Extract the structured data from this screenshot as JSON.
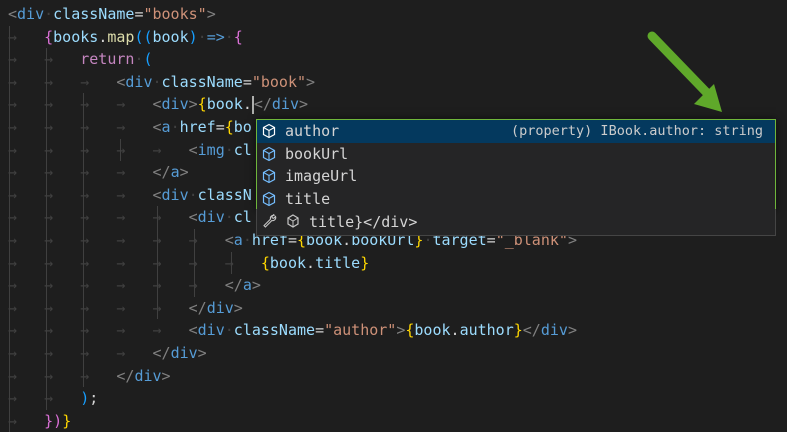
{
  "editor": {
    "lines": [
      {
        "segments": [
          {
            "c": "tag",
            "t": "<"
          },
          {
            "c": "tname",
            "t": "div"
          },
          {
            "c": "ws",
            "t": "·"
          },
          {
            "c": "attr",
            "t": "className"
          },
          {
            "c": "plain",
            "t": "="
          },
          {
            "c": "str",
            "t": "\"books\""
          },
          {
            "c": "tag",
            "t": ">"
          }
        ]
      },
      {
        "segments": [
          {
            "c": "ws",
            "t": "→   "
          },
          {
            "c": "brace",
            "t": "{"
          },
          {
            "c": "var",
            "t": "books"
          },
          {
            "c": "plain",
            "t": "."
          },
          {
            "c": "fn",
            "t": "map"
          },
          {
            "c": "brace2",
            "t": "(("
          },
          {
            "c": "var",
            "t": "book"
          },
          {
            "c": "brace2",
            "t": ")"
          },
          {
            "c": "ws",
            "t": "·"
          },
          {
            "c": "tname",
            "t": "=>"
          },
          {
            "c": "ws",
            "t": "·"
          },
          {
            "c": "brace",
            "t": "{"
          }
        ]
      },
      {
        "segments": [
          {
            "c": "ws",
            "t": "→   →   "
          },
          {
            "c": "kw",
            "t": "return"
          },
          {
            "c": "ws",
            "t": "·"
          },
          {
            "c": "brace2",
            "t": "("
          }
        ]
      },
      {
        "segments": [
          {
            "c": "ws",
            "t": "→   →   →   "
          },
          {
            "c": "tag",
            "t": "<"
          },
          {
            "c": "tname",
            "t": "div"
          },
          {
            "c": "ws",
            "t": "·"
          },
          {
            "c": "attr",
            "t": "className"
          },
          {
            "c": "plain",
            "t": "="
          },
          {
            "c": "str",
            "t": "\"book\""
          },
          {
            "c": "tag",
            "t": ">"
          }
        ]
      },
      {
        "segments": [
          {
            "c": "ws",
            "t": "→   →   →   →   "
          },
          {
            "c": "tag",
            "t": "<"
          },
          {
            "c": "tname",
            "t": "div"
          },
          {
            "c": "tag",
            "t": ">"
          },
          {
            "c": "brace3",
            "t": "{"
          },
          {
            "c": "var",
            "t": "book"
          },
          {
            "c": "plain",
            "t": "."
          },
          {
            "c": "cursor",
            "t": ""
          },
          {
            "c": "tag",
            "t": "</"
          },
          {
            "c": "tname",
            "t": "div"
          },
          {
            "c": "tag",
            "t": ">"
          }
        ]
      },
      {
        "segments": [
          {
            "c": "ws",
            "t": "→   →   →   →   "
          },
          {
            "c": "tag",
            "t": "<"
          },
          {
            "c": "tname",
            "t": "a"
          },
          {
            "c": "ws",
            "t": "·"
          },
          {
            "c": "attr",
            "t": "href"
          },
          {
            "c": "plain",
            "t": "="
          },
          {
            "c": "brace3",
            "t": "{"
          },
          {
            "c": "var",
            "t": "bo"
          }
        ]
      },
      {
        "segments": [
          {
            "c": "ws",
            "t": "→   →   →   →   →   "
          },
          {
            "c": "tag",
            "t": "<"
          },
          {
            "c": "tname",
            "t": "img"
          },
          {
            "c": "ws",
            "t": "·"
          },
          {
            "c": "attr",
            "t": "cl"
          }
        ]
      },
      {
        "segments": [
          {
            "c": "ws",
            "t": "→   →   →   →   "
          },
          {
            "c": "tag",
            "t": "</"
          },
          {
            "c": "tname",
            "t": "a"
          },
          {
            "c": "tag",
            "t": ">"
          }
        ]
      },
      {
        "segments": [
          {
            "c": "ws",
            "t": "→   →   →   →   "
          },
          {
            "c": "tag",
            "t": "<"
          },
          {
            "c": "tname",
            "t": "div"
          },
          {
            "c": "ws",
            "t": "·"
          },
          {
            "c": "attr",
            "t": "classN"
          }
        ]
      },
      {
        "segments": [
          {
            "c": "ws",
            "t": "→   →   →   →   →   "
          },
          {
            "c": "tag",
            "t": "<"
          },
          {
            "c": "tname",
            "t": "div"
          },
          {
            "c": "ws",
            "t": "·"
          },
          {
            "c": "attr",
            "t": "cl"
          }
        ]
      },
      {
        "segments": [
          {
            "c": "ws",
            "t": "→   →   →   →   →   →   "
          },
          {
            "c": "tag",
            "t": "<"
          },
          {
            "c": "tname",
            "t": "a"
          },
          {
            "c": "ws",
            "t": "·"
          },
          {
            "c": "attr",
            "t": "href"
          },
          {
            "c": "plain",
            "t": "="
          },
          {
            "c": "brace3",
            "t": "{"
          },
          {
            "c": "var",
            "t": "book"
          },
          {
            "c": "plain",
            "t": "."
          },
          {
            "c": "var",
            "t": "bookUrl"
          },
          {
            "c": "brace3",
            "t": "}"
          },
          {
            "c": "ws",
            "t": "·"
          },
          {
            "c": "attr",
            "t": "target"
          },
          {
            "c": "plain",
            "t": "="
          },
          {
            "c": "str",
            "t": "\"_blank\""
          },
          {
            "c": "tag",
            "t": ">"
          }
        ]
      },
      {
        "segments": [
          {
            "c": "ws",
            "t": "→   →   →   →   →   →   →   "
          },
          {
            "c": "brace3",
            "t": "{"
          },
          {
            "c": "var",
            "t": "book"
          },
          {
            "c": "plain",
            "t": "."
          },
          {
            "c": "var",
            "t": "title"
          },
          {
            "c": "brace3",
            "t": "}"
          }
        ]
      },
      {
        "segments": [
          {
            "c": "ws",
            "t": "→   →   →   →   →   →   "
          },
          {
            "c": "tag",
            "t": "</"
          },
          {
            "c": "tname",
            "t": "a"
          },
          {
            "c": "tag",
            "t": ">"
          }
        ]
      },
      {
        "segments": [
          {
            "c": "ws",
            "t": "→   →   →   →   →   "
          },
          {
            "c": "tag",
            "t": "</"
          },
          {
            "c": "tname",
            "t": "div"
          },
          {
            "c": "tag",
            "t": ">"
          }
        ]
      },
      {
        "segments": [
          {
            "c": "ws",
            "t": "→   →   →   →   →   "
          },
          {
            "c": "tag",
            "t": "<"
          },
          {
            "c": "tname",
            "t": "div"
          },
          {
            "c": "ws",
            "t": "·"
          },
          {
            "c": "attr",
            "t": "className"
          },
          {
            "c": "plain",
            "t": "="
          },
          {
            "c": "str",
            "t": "\"author\""
          },
          {
            "c": "tag",
            "t": ">"
          },
          {
            "c": "brace3",
            "t": "{"
          },
          {
            "c": "var",
            "t": "book"
          },
          {
            "c": "plain",
            "t": "."
          },
          {
            "c": "var",
            "t": "author"
          },
          {
            "c": "brace3",
            "t": "}"
          },
          {
            "c": "tag",
            "t": "</"
          },
          {
            "c": "tname",
            "t": "div"
          },
          {
            "c": "tag",
            "t": ">"
          }
        ]
      },
      {
        "segments": [
          {
            "c": "ws",
            "t": "→   →   →   →   "
          },
          {
            "c": "tag",
            "t": "</"
          },
          {
            "c": "tname",
            "t": "div"
          },
          {
            "c": "tag",
            "t": ">"
          }
        ]
      },
      {
        "segments": [
          {
            "c": "ws",
            "t": "→   →   →   "
          },
          {
            "c": "tag",
            "t": "</"
          },
          {
            "c": "tname",
            "t": "div"
          },
          {
            "c": "tag",
            "t": ">"
          }
        ]
      },
      {
        "segments": [
          {
            "c": "ws",
            "t": "→   →   "
          },
          {
            "c": "brace2",
            "t": ")"
          },
          {
            "c": "plain",
            "t": ";"
          }
        ]
      },
      {
        "segments": [
          {
            "c": "ws",
            "t": "→   "
          },
          {
            "c": "brace",
            "t": "})"
          },
          {
            "c": "brace3",
            "t": "}"
          }
        ]
      }
    ]
  },
  "suggest": {
    "items": [
      {
        "label": "author",
        "detail": "(property) IBook.author: string",
        "icon": "property-icon",
        "selected": true
      },
      {
        "label": "bookUrl",
        "detail": "",
        "icon": "property-icon",
        "selected": false
      },
      {
        "label": "imageUrl",
        "detail": "",
        "icon": "property-icon",
        "selected": false
      },
      {
        "label": "title",
        "detail": "",
        "icon": "property-icon",
        "selected": false
      }
    ],
    "hint_text": "title}</div>",
    "hint_icons": [
      "wrench-icon",
      "module-icon"
    ]
  },
  "colors": {
    "background": "#1e1e1e",
    "selection": "#04395e",
    "highlight_border": "#6fb63b",
    "arrow": "#5fa82a"
  }
}
